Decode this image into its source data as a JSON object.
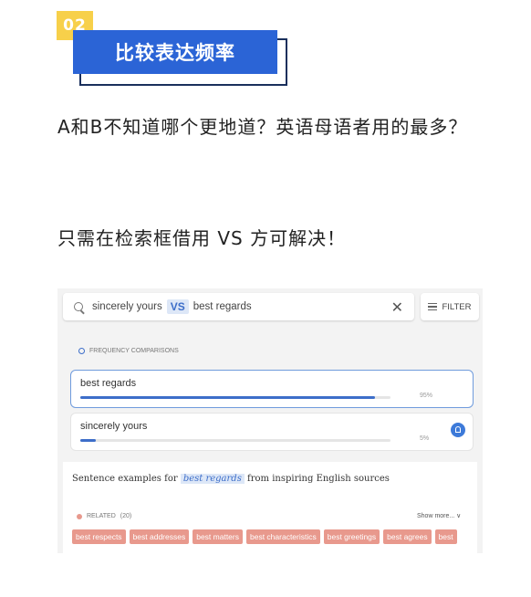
{
  "header": {
    "badge": "02",
    "title": "比较表达频率"
  },
  "paragraphs": {
    "p1": "A和B不知道哪个更地道？英语母语者用的最多？",
    "p2": "只需在检索框借用 VS 方可解决！"
  },
  "search": {
    "term_a": "sincerely yours",
    "vs_label": "VS",
    "term_b": "best regards",
    "clear_symbol": "✕",
    "filter_label": "FILTER"
  },
  "frequency": {
    "header": "FREQUENCY COMPARISONS",
    "items": [
      {
        "phrase": "best regards",
        "percent_label": "95%",
        "fraction": 0.95
      },
      {
        "phrase": "sincerely yours",
        "percent_label": "5%",
        "fraction": 0.05
      }
    ]
  },
  "examples": {
    "prefix": "Sentence examples for",
    "highlight": "best regards",
    "suffix": "from inspiring English sources"
  },
  "related": {
    "label": "RELATED",
    "count": "(20)",
    "show_more": "Show more... ∨",
    "tags": [
      "best respects",
      "best addresses",
      "best matters",
      "best characteristics",
      "best greetings",
      "best agrees",
      "best"
    ]
  },
  "colors": {
    "badge": "#f7d04a",
    "title_bg": "#2b64d6",
    "accent": "#3d6ec9",
    "tag": "#e8998d"
  }
}
